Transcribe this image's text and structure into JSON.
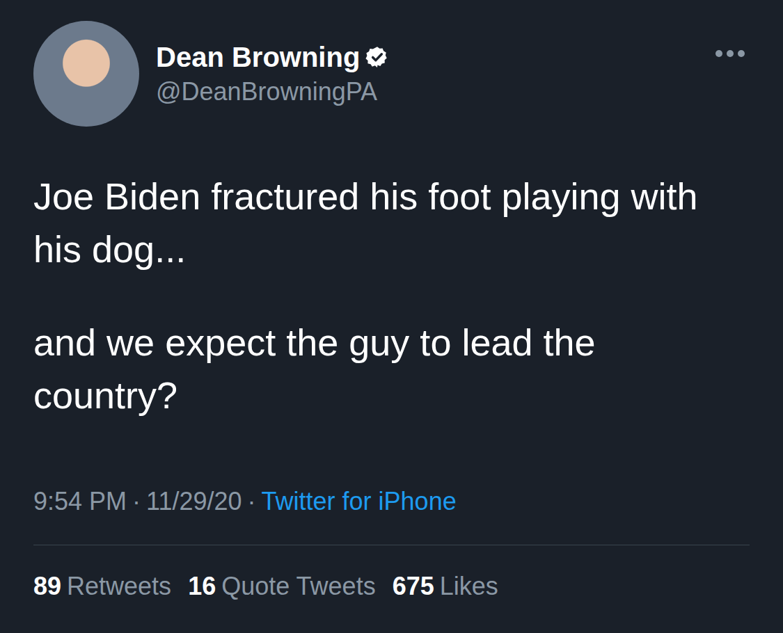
{
  "tweet": {
    "author": {
      "name": "Dean Browning",
      "handle": "@DeanBrowningPA",
      "verified": true
    },
    "text": [
      "Joe Biden fractured his foot playing with his dog...",
      "and we expect the guy to lead the country?"
    ],
    "time": "9:54 PM",
    "separator": "·",
    "date": "11/29/20",
    "source": "Twitter for iPhone",
    "stats": [
      {
        "count": "89",
        "label": "Retweets"
      },
      {
        "count": "16",
        "label": "Quote Tweets"
      },
      {
        "count": "675",
        "label": "Likes"
      }
    ]
  }
}
